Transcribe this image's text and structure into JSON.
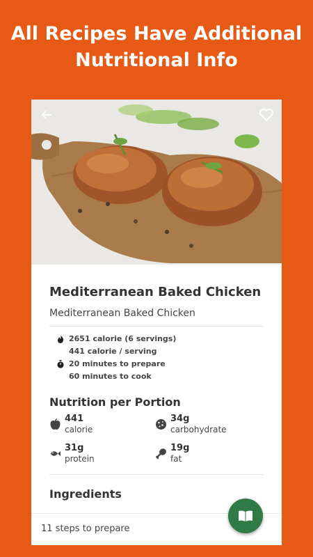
{
  "promo": {
    "line1": "All Recipes Have Additional",
    "line2": "Nutritional Info"
  },
  "recipe": {
    "title": "Mediterranean Baked Chicken",
    "subtitle": "Mediterranean Baked Chicken",
    "total_calories": "2651 calorie (6 servings)",
    "serving_calories": "441 calorie / serving",
    "prep_time": "20 minutes to prepare",
    "cook_time": "60 minutes to cook"
  },
  "nutrition": {
    "heading": "Nutrition per Portion",
    "items": [
      {
        "value": "441",
        "label": "calorie",
        "icon": "apple-icon"
      },
      {
        "value": "34g",
        "label": "carbohydrate",
        "icon": "cookie-icon"
      },
      {
        "value": "31g",
        "label": "protein",
        "icon": "fish-icon"
      },
      {
        "value": "19g",
        "label": "fat",
        "icon": "drumstick-icon"
      }
    ]
  },
  "ingredients": {
    "heading": "Ingredients"
  },
  "footer": {
    "steps": "11 steps to prepare"
  },
  "colors": {
    "background": "#e65a16",
    "fab": "#2f7a45"
  }
}
